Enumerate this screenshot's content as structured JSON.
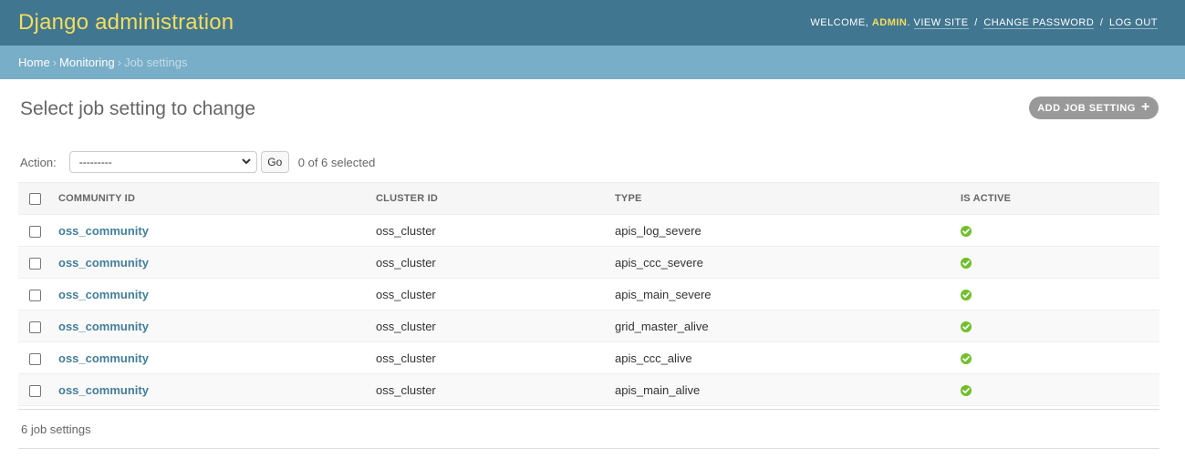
{
  "header": {
    "branding": "Django administration",
    "welcome": "Welcome,",
    "username": "admin",
    "view_site": "View site",
    "change_password": "Change password",
    "log_out": "Log out",
    "separator": "/"
  },
  "breadcrumbs": {
    "home": "Home",
    "app": "Monitoring",
    "current": "Job settings",
    "arrow": "›"
  },
  "page": {
    "title": "Select job setting to change",
    "add_button": "Add job setting",
    "add_icon": "+"
  },
  "actions": {
    "label": "Action:",
    "selected_value": "---------",
    "go_label": "Go",
    "selected_count": "0 of 6 selected"
  },
  "table": {
    "columns": [
      "Community ID",
      "Cluster ID",
      "Type",
      "Is active"
    ],
    "rows": [
      {
        "community": "oss_community",
        "cluster": "oss_cluster",
        "type": "apis_log_severe",
        "is_active": true
      },
      {
        "community": "oss_community",
        "cluster": "oss_cluster",
        "type": "apis_ccc_severe",
        "is_active": true
      },
      {
        "community": "oss_community",
        "cluster": "oss_cluster",
        "type": "apis_main_severe",
        "is_active": true
      },
      {
        "community": "oss_community",
        "cluster": "oss_cluster",
        "type": "grid_master_alive",
        "is_active": true
      },
      {
        "community": "oss_community",
        "cluster": "oss_cluster",
        "type": "apis_ccc_alive",
        "is_active": true
      },
      {
        "community": "oss_community",
        "cluster": "oss_cluster",
        "type": "apis_main_alive",
        "is_active": true
      }
    ]
  },
  "paginator": {
    "text": "6 job settings"
  },
  "colors": {
    "header_bg": "#417690",
    "branding": "#f5dd5d",
    "breadcrumbs_bg": "#79aec8",
    "link": "#447e9b",
    "active_icon": "#70bf2b",
    "add_button_bg": "#999999"
  }
}
